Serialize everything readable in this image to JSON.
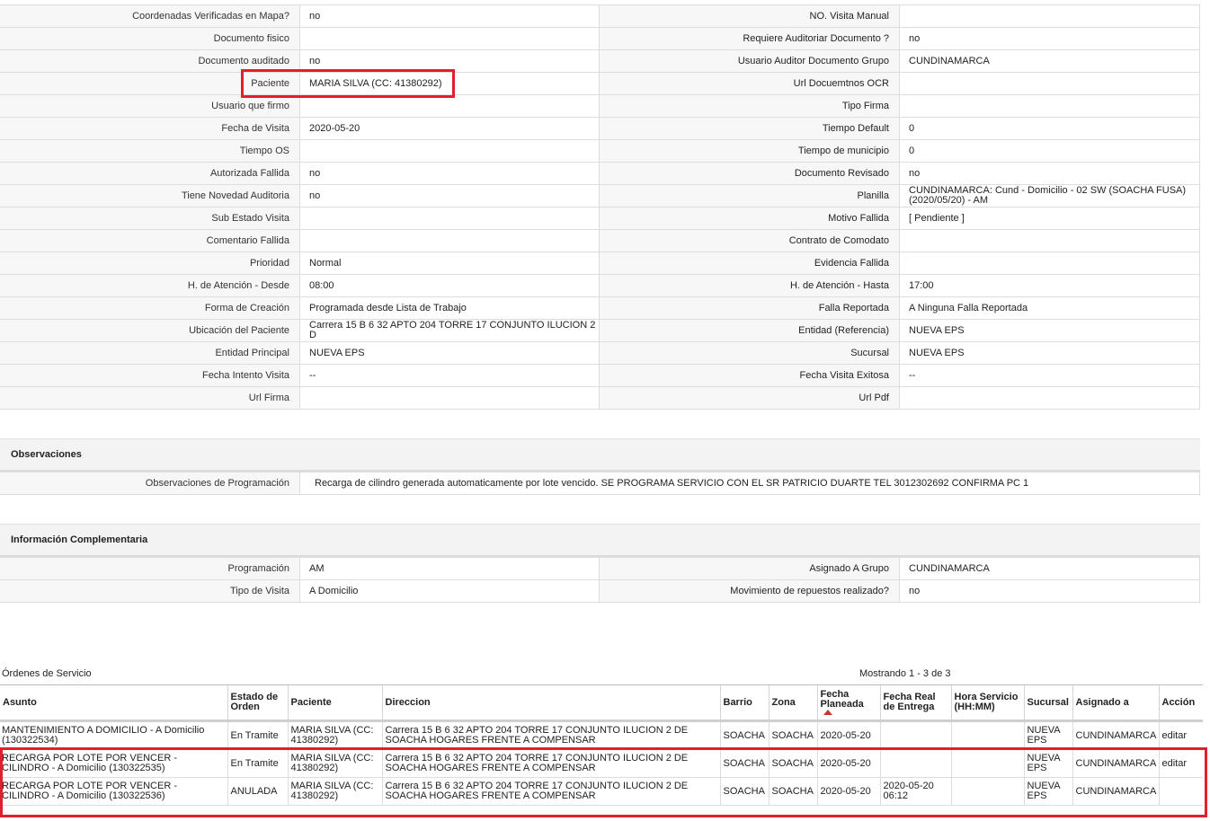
{
  "details": [
    {
      "l": "Coordenadas Verificadas en Mapa?",
      "v": "no",
      "l2": "NO. Visita Manual",
      "v2": ""
    },
    {
      "l": "Documento fisico",
      "v": "",
      "l2": "Requiere Auditoriar Documento ?",
      "v2": "no"
    },
    {
      "l": "Documento auditado",
      "v": "no",
      "l2": "Usuario Auditor Documento Grupo",
      "v2": "CUNDINAMARCA"
    },
    {
      "l": "Paciente",
      "v": "MARIA SILVA (CC: 41380292)",
      "l2": "Url Docuemtnos OCR",
      "v2": ""
    },
    {
      "l": "Usuario que firmo",
      "v": "",
      "l2": "Tipo Firma",
      "v2": ""
    },
    {
      "l": "Fecha de Visita",
      "v": "2020-05-20",
      "l2": "Tiempo Default",
      "v2": "0"
    },
    {
      "l": "Tiempo OS",
      "v": "",
      "l2": "Tiempo de municipio",
      "v2": "0"
    },
    {
      "l": "Autorizada Fallida",
      "v": "no",
      "l2": "Documento Revisado",
      "v2": "no"
    },
    {
      "l": "Tiene Novedad Auditoria",
      "v": "no",
      "l2": "Planilla",
      "v2": "CUNDINAMARCA: Cund - Domicilio - 02 SW (SOACHA FUSA) (2020/05/20) - AM"
    },
    {
      "l": "Sub Estado Visita",
      "v": "",
      "l2": "Motivo Fallida",
      "v2": "[ Pendiente ]"
    },
    {
      "l": "Comentario Fallida",
      "v": "",
      "l2": "Contrato de Comodato",
      "v2": ""
    },
    {
      "l": "Prioridad",
      "v": "Normal",
      "l2": "Evidencia Fallida",
      "v2": ""
    },
    {
      "l": "H. de Atención - Desde",
      "v": "08:00",
      "l2": "H. de Atención - Hasta",
      "v2": "17:00"
    },
    {
      "l": "Forma de Creación",
      "v": "Programada desde Lista de Trabajo",
      "l2": "Falla Reportada",
      "v2": "A Ninguna Falla Reportada"
    },
    {
      "l": "Ubicación del Paciente",
      "v": "Carrera 15 B 6 32 APTO 204 TORRE 17 CONJUNTO ILUCION 2 D",
      "l2": "Entidad (Referencia)",
      "v2": "NUEVA EPS"
    },
    {
      "l": "Entidad Principal",
      "v": "NUEVA EPS",
      "l2": "Sucursal",
      "v2": "NUEVA EPS"
    },
    {
      "l": "Fecha Intento Visita",
      "v": "--",
      "l2": "Fecha Visita Exitosa",
      "v2": "--"
    },
    {
      "l": "Url Firma",
      "v": "",
      "l2": "Url Pdf",
      "v2": ""
    }
  ],
  "observaciones": {
    "title": "Observaciones",
    "label": "Observaciones de Programación",
    "value": "Recarga de cilindro generada automaticamente por lote vencido. SE PROGRAMA SERVICIO CON EL SR PATRICIO DUARTE TEL 3012302692 CONFIRMA PC 1"
  },
  "complementaria": {
    "title": "Información Complementaria",
    "rows": [
      {
        "l": "Programación",
        "v": "AM",
        "l2": "Asignado A Grupo",
        "v2": "CUNDINAMARCA"
      },
      {
        "l": "Tipo de Visita",
        "v": "A Domicilio",
        "l2": "Movimiento de repuestos realizado?",
        "v2": "no"
      }
    ]
  },
  "ordenes": {
    "title": "Órdenes de Servicio",
    "showing": "Mostrando 1 - 3 de 3",
    "headers": [
      "Asunto",
      "Estado de Orden",
      "Paciente",
      "Direccion",
      "Barrio",
      "Zona",
      "Fecha Planeada",
      "Fecha Real de Entrega",
      "Hora Servicio (HH:MM)",
      "Sucursal",
      "Asignado a",
      "Acción"
    ],
    "rows": [
      [
        "MANTENIMIENTO A DOMICILIO - A Domicilio (130322534)",
        "En Tramite",
        "MARIA SILVA (CC: 41380292)",
        "Carrera 15 B 6 32 APTO 204 TORRE 17 CONJUNTO ILUCION 2 DE SOACHA HOGARES FRENTE A COMPENSAR",
        "SOACHA",
        "SOACHA",
        "2020-05-20",
        "",
        "",
        "NUEVA EPS",
        "CUNDINAMARCA",
        "editar"
      ],
      [
        "RECARGA POR LOTE POR VENCER - CILINDRO - A Domicilio (130322535)",
        "En Tramite",
        "MARIA SILVA (CC: 41380292)",
        "Carrera 15 B 6 32 APTO 204 TORRE 17 CONJUNTO ILUCION 2 DE SOACHA HOGARES FRENTE A COMPENSAR",
        "SOACHA",
        "SOACHA",
        "2020-05-20",
        "",
        "",
        "NUEVA EPS",
        "CUNDINAMARCA",
        "editar"
      ],
      [
        "RECARGA POR LOTE POR VENCER - CILINDRO - A Domicilio (130322536)",
        "ANULADA",
        "MARIA SILVA (CC: 41380292)",
        "Carrera 15 B 6 32 APTO 204 TORRE 17 CONJUNTO ILUCION 2 DE SOACHA HOGARES FRENTE A COMPENSAR",
        "SOACHA",
        "SOACHA",
        "2020-05-20",
        "2020-05-20 06:12",
        "",
        "NUEVA EPS",
        "CUNDINAMARCA",
        ""
      ]
    ]
  },
  "colors": {
    "highlight": "#e0202a",
    "sort_indicator": "#c0392b"
  }
}
